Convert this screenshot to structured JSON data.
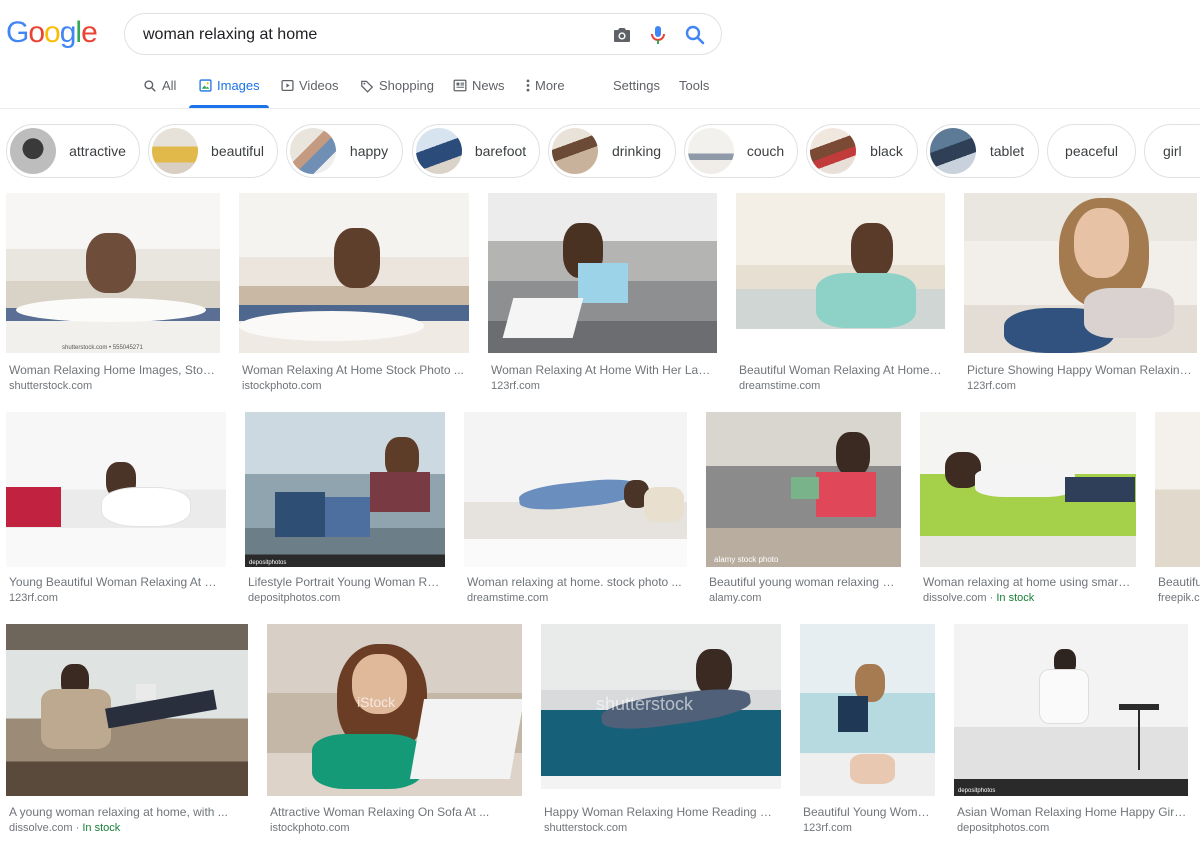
{
  "logo": {
    "letters": [
      "G",
      "o",
      "o",
      "g",
      "l",
      "e"
    ],
    "colors": [
      "#4285F4",
      "#EA4335",
      "#FBBC05",
      "#4285F4",
      "#34A853",
      "#EA4335"
    ]
  },
  "search": {
    "query": "woman relaxing at home"
  },
  "tabs": [
    {
      "label": "All",
      "icon": "search-icon"
    },
    {
      "label": "Images",
      "icon": "image-icon",
      "active": true
    },
    {
      "label": "Videos",
      "icon": "video-icon"
    },
    {
      "label": "Shopping",
      "icon": "tag-icon"
    },
    {
      "label": "News",
      "icon": "news-icon"
    },
    {
      "label": "More",
      "icon": "more-icon"
    },
    {
      "label": "Settings"
    },
    {
      "label": "Tools"
    }
  ],
  "chips": [
    "attractive",
    "beautiful",
    "happy",
    "barefoot",
    "drinking",
    "couch",
    "black",
    "tablet",
    "peaceful",
    "girl"
  ],
  "results": [
    {
      "title": "Woman Relaxing Home Images, Stock ...",
      "source": "shutterstock.com",
      "watermark": "shutterstock.com • 555045271"
    },
    {
      "title": "Woman Relaxing At Home Stock Photo ...",
      "source": "istockphoto.com"
    },
    {
      "title": "Woman Relaxing At Home With Her Lapto...",
      "source": "123rf.com"
    },
    {
      "title": "Beautiful Woman Relaxing At Home St...",
      "source": "dreamstime.com"
    },
    {
      "title": "Picture Showing Happy Woman Relaxing A...",
      "source": "123rf.com"
    },
    {
      "title": "Young Beautiful Woman Relaxing At Ho...",
      "source": "123rf.com"
    },
    {
      "title": "Lifestyle Portrait Young Woman Rel...",
      "source": "depositphotos.com",
      "watermark": "depositphotos"
    },
    {
      "title": "Woman relaxing at home. stock photo ...",
      "source": "dreamstime.com"
    },
    {
      "title": "Beautiful young woman relaxing at ...",
      "source": "alamy.com",
      "watermark": "alamy stock photo"
    },
    {
      "title": "Woman relaxing at home using smartp...",
      "source": "dissolve.com",
      "badge": "In stock"
    },
    {
      "title": "Beautifu",
      "source": "freepik.c"
    },
    {
      "title": "A young woman relaxing at home, with ...",
      "source": "dissolve.com",
      "badge": "In stock"
    },
    {
      "title": "Attractive Woman Relaxing On Sofa At ...",
      "source": "istockphoto.com",
      "watermark": "iStock"
    },
    {
      "title": "Happy Woman Relaxing Home Reading Boo...",
      "source": "shutterstock.com",
      "watermark": "shutterstock"
    },
    {
      "title": "Beautiful Young Woma...",
      "source": "123rf.com"
    },
    {
      "title": "Asian Woman Relaxing Home Happy Girl ...",
      "source": "depositphotos.com",
      "watermark": "depositphotos"
    }
  ],
  "bullet": "·"
}
